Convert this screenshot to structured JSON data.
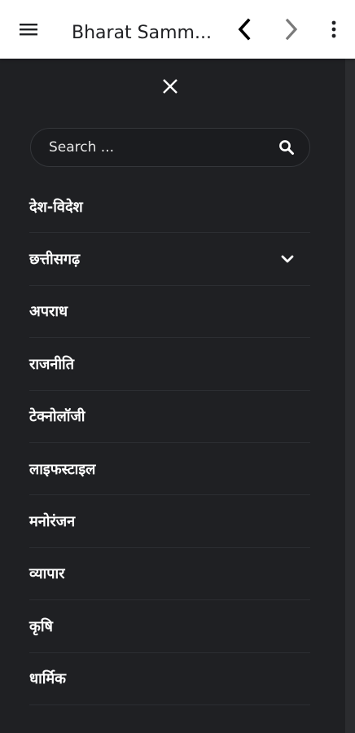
{
  "app": {
    "title": "Bharat Samm...",
    "colors": {
      "toolbar_bg": "#ffffff",
      "drawer_bg": "#1f2023",
      "text_light": "#ffffff",
      "text_dark": "#202124",
      "divider": "#2c2e32"
    }
  },
  "toolbar": {
    "menu_icon": "hamburger-icon",
    "back_icon": "chevron-left-icon",
    "forward_icon": "chevron-right-icon",
    "more_icon": "more-vertical-icon"
  },
  "drawer": {
    "close_icon": "close-icon",
    "search": {
      "placeholder": "Search ...",
      "value": "",
      "icon": "search-icon"
    },
    "items": [
      {
        "label": "देश-विदेश"
      },
      {
        "label": "छत्तीसगढ़",
        "expandable": true,
        "icon": "chevron-down-icon"
      },
      {
        "label": "अपराध"
      },
      {
        "label": "राजनीति"
      },
      {
        "label": "टेक्नोलॉजी"
      },
      {
        "label": "लाइफस्टाइल"
      },
      {
        "label": "मनोरंजन"
      },
      {
        "label": "व्यापार"
      },
      {
        "label": "कृषि"
      },
      {
        "label": "धार्मिक"
      }
    ]
  }
}
